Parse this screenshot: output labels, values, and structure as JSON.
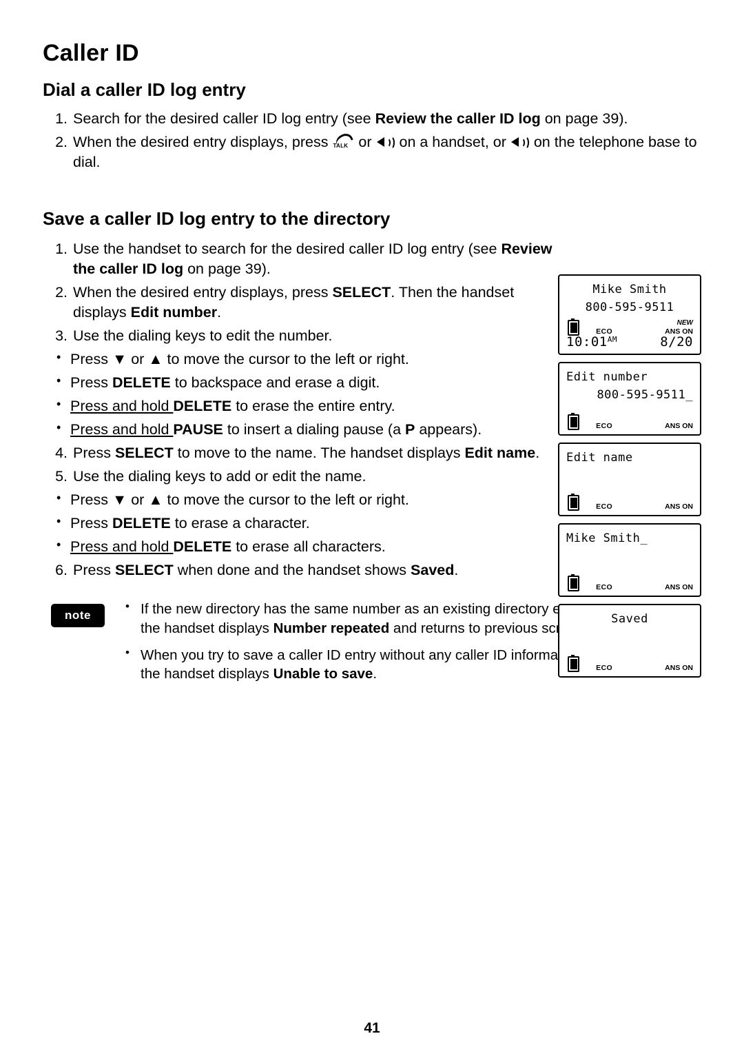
{
  "chapter_title": "Caller ID",
  "section1": {
    "title": "Dial a caller ID log entry",
    "step1_a": "Search for the desired caller ID log entry (see ",
    "step1_b": "Review the caller ID log",
    "step1_c": " on page 39).",
    "step2_a": "When the desired entry displays, press ",
    "step2_b": " or ",
    "step2_c": " on a handset, or ",
    "step2_d": " on the telephone base to dial.",
    "num1": "1.",
    "num2": "2."
  },
  "section2": {
    "title": "Save a caller ID log entry to the directory",
    "num1": "1.",
    "num2": "2.",
    "num3": "3.",
    "num4": "4.",
    "num5": "5.",
    "num6": "6.",
    "step1_a": "Use the handset to search for the desired caller ID log entry (see ",
    "step1_b": "Review the caller ID log",
    "step1_c": " on page 39).",
    "step2_a": "When the desired entry displays, press ",
    "step2_b": "SELECT",
    "step2_c": ". Then the handset displays ",
    "step2_d": "Edit number",
    "step2_e": ".",
    "step3": "Use the dialing keys to edit the number.",
    "bullet3_1_a": "Press ",
    "bullet3_1_b": " or ",
    "bullet3_1_c": " to move the cursor to the left or right.",
    "bullet3_2_a": "Press ",
    "bullet3_2_b": "DELETE",
    "bullet3_2_c": " to backspace and erase a digit.",
    "bullet3_3_a": "Press and hold ",
    "bullet3_3_b": "DELETE",
    "bullet3_3_c": " to erase the entire entry.",
    "bullet3_4_a": "Press and hold ",
    "bullet3_4_b": "PAUSE",
    "bullet3_4_c": " to insert a dialing pause (a ",
    "bullet3_4_d": "P",
    "bullet3_4_e": " appears).",
    "step4_a": "Press ",
    "step4_b": "SELECT",
    "step4_c": " to move to the name. The handset displays ",
    "step4_d": "Edit name",
    "step4_e": ".",
    "step5": "Use the dialing keys to add or edit the name.",
    "bullet5_1_a": "Press ",
    "bullet5_1_b": " or ",
    "bullet5_1_c": " to move the cursor to the left or right.",
    "bullet5_2_a": "Press ",
    "bullet5_2_b": "DELETE",
    "bullet5_2_c": " to erase a character.",
    "bullet5_3_a": "Press and hold ",
    "bullet5_3_b": "DELETE",
    "bullet5_3_c": " to erase all characters.",
    "step6_a": "Press ",
    "step6_b": "SELECT",
    "step6_c": " when done and the handset shows ",
    "step6_d": "Saved",
    "step6_e": "."
  },
  "note": {
    "badge": "note",
    "b1_a": "If the new directory has the same number as an existing directory entry, the handset displays ",
    "b1_b": "Number repeated",
    "b1_c": " and returns to previous screen.",
    "b2_a": "When you try to save a caller ID entry without any caller ID information, the handset displays ",
    "b2_b": "Unable to save",
    "b2_c": "."
  },
  "screens": [
    {
      "name": "caller-id-entry",
      "line1": "Mike Smith",
      "line2": "800-595-9511",
      "eco": "ECO",
      "new": "NEW",
      "ans": "ANS ON",
      "time": "10:01",
      "time_sup": "AM",
      "date": "8/20"
    },
    {
      "name": "edit-number",
      "line1": "Edit number",
      "line2": "800-595-9511_",
      "eco": "ECO",
      "ans": "ANS ON"
    },
    {
      "name": "edit-name-empty",
      "line1": "Edit name",
      "line2": "",
      "eco": "ECO",
      "ans": "ANS ON"
    },
    {
      "name": "edit-name-filled",
      "line1": "Mike Smith_",
      "line2": "",
      "eco": "ECO",
      "ans": "ANS ON"
    },
    {
      "name": "saved",
      "line1": "Saved",
      "line2": "",
      "eco": "ECO",
      "ans": "ANS ON"
    }
  ],
  "page_number": "41"
}
